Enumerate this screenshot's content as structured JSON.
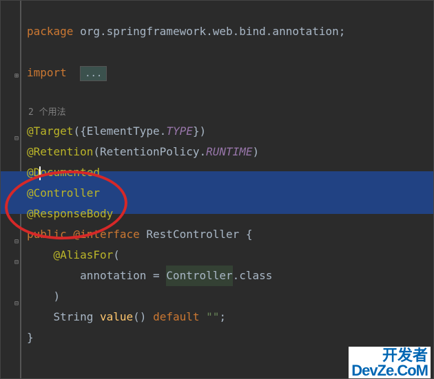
{
  "package_line": {
    "keyword": "package",
    "name": "org.springframework.web.bind.annotation"
  },
  "import_line": {
    "keyword": "import",
    "folded": "..."
  },
  "usages_hint": "2 个用法",
  "annotations": {
    "target": {
      "name": "@Target",
      "arg_type": "ElementType",
      "arg_field": "TYPE"
    },
    "retention": {
      "name": "@Retention",
      "arg_type": "RetentionPolicy",
      "arg_field": "RUNTIME"
    },
    "documented": "@Documented",
    "controller": "@Controller",
    "responsebody": "@ResponseBody"
  },
  "declaration": {
    "modifier": "public",
    "kw": "@interface",
    "name": "RestController"
  },
  "alias_for": {
    "name": "@AliasFor",
    "attr": "annotation",
    "value_type": "Controller",
    "value_suffix": ".class"
  },
  "value_method": {
    "type": "String",
    "name": "value",
    "default_kw": "default",
    "default_val": "\"\""
  },
  "punct": {
    "semicolon": ";",
    "lparen": "(",
    "rparen": ")",
    "lbrace": "{",
    "rbrace": "}",
    "lbracket_brace": "({",
    "rbracket_brace": "})",
    "dot": ".",
    "eq": " = "
  },
  "watermark": {
    "top": "开发者",
    "bottom": "DevZe.CoM"
  }
}
